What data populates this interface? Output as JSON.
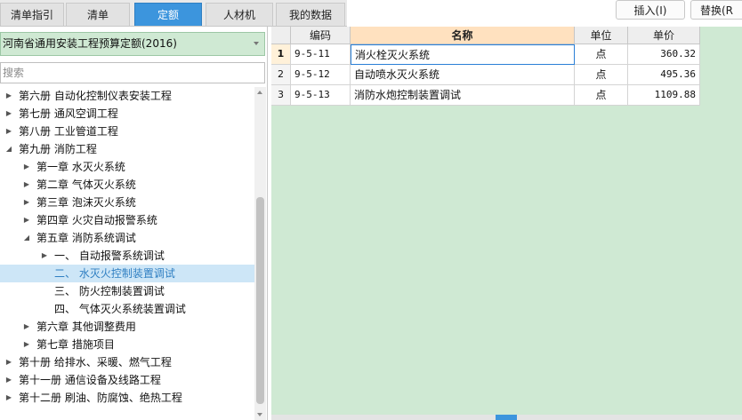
{
  "tabs": [
    {
      "label": "清单指引",
      "active": false
    },
    {
      "label": "清单",
      "active": false
    },
    {
      "label": "定额",
      "active": true
    },
    {
      "label": "人材机",
      "active": false
    },
    {
      "label": "我的数据",
      "active": false
    }
  ],
  "toolbar": {
    "insert_label": "插入(I)",
    "replace_label": "替换(R"
  },
  "library": {
    "selected": "河南省通用安装工程预算定额(2016)"
  },
  "search": {
    "placeholder": "搜索"
  },
  "tree": [
    {
      "label": "第六册 自动化控制仪表安装工程",
      "level": 0,
      "state": "collapsed"
    },
    {
      "label": "第七册 通风空调工程",
      "level": 0,
      "state": "collapsed"
    },
    {
      "label": "第八册 工业管道工程",
      "level": 0,
      "state": "collapsed"
    },
    {
      "label": "第九册 消防工程",
      "level": 0,
      "state": "expanded"
    },
    {
      "label": "第一章 水灭火系统",
      "level": 1,
      "state": "collapsed"
    },
    {
      "label": "第二章 气体灭火系统",
      "level": 1,
      "state": "collapsed"
    },
    {
      "label": "第三章 泡沫灭火系统",
      "level": 1,
      "state": "collapsed"
    },
    {
      "label": "第四章 火灾自动报警系统",
      "level": 1,
      "state": "collapsed"
    },
    {
      "label": "第五章 消防系统调试",
      "level": 1,
      "state": "expanded"
    },
    {
      "label": "一、 自动报警系统调试",
      "level": 2,
      "state": "collapsed"
    },
    {
      "label": "二、 水灭火控制装置调试",
      "level": 2,
      "state": "leaf",
      "selected": true
    },
    {
      "label": "三、 防火控制装置调试",
      "level": 2,
      "state": "leaf"
    },
    {
      "label": "四、 气体灭火系统装置调试",
      "level": 2,
      "state": "leaf"
    },
    {
      "label": "第六章 其他调整费用",
      "level": 1,
      "state": "collapsed"
    },
    {
      "label": "第七章 措施项目",
      "level": 1,
      "state": "collapsed"
    },
    {
      "label": "第十册 给排水、采暖、燃气工程",
      "level": 0,
      "state": "collapsed"
    },
    {
      "label": "第十一册 通信设备及线路工程",
      "level": 0,
      "state": "collapsed"
    },
    {
      "label": "第十二册 刷油、防腐蚀、绝热工程",
      "level": 0,
      "state": "collapsed"
    }
  ],
  "grid": {
    "headers": {
      "code": "编码",
      "name": "名称",
      "unit": "单位",
      "price": "单价"
    },
    "rows": [
      {
        "num": "1",
        "code": "9-5-11",
        "name": "消火栓灭火系统",
        "unit": "点",
        "price": "360.32"
      },
      {
        "num": "2",
        "code": "9-5-12",
        "name": "自动喷水灭火系统",
        "unit": "点",
        "price": "495.36"
      },
      {
        "num": "3",
        "code": "9-5-13",
        "name": "消防水炮控制装置调试",
        "unit": "点",
        "price": "1109.88"
      }
    ]
  },
  "colors": {
    "accent": "#3c95dd",
    "grid_bg": "#cfe9d3",
    "header_highlight": "#ffe1bf",
    "selection": "#cde6f7"
  }
}
